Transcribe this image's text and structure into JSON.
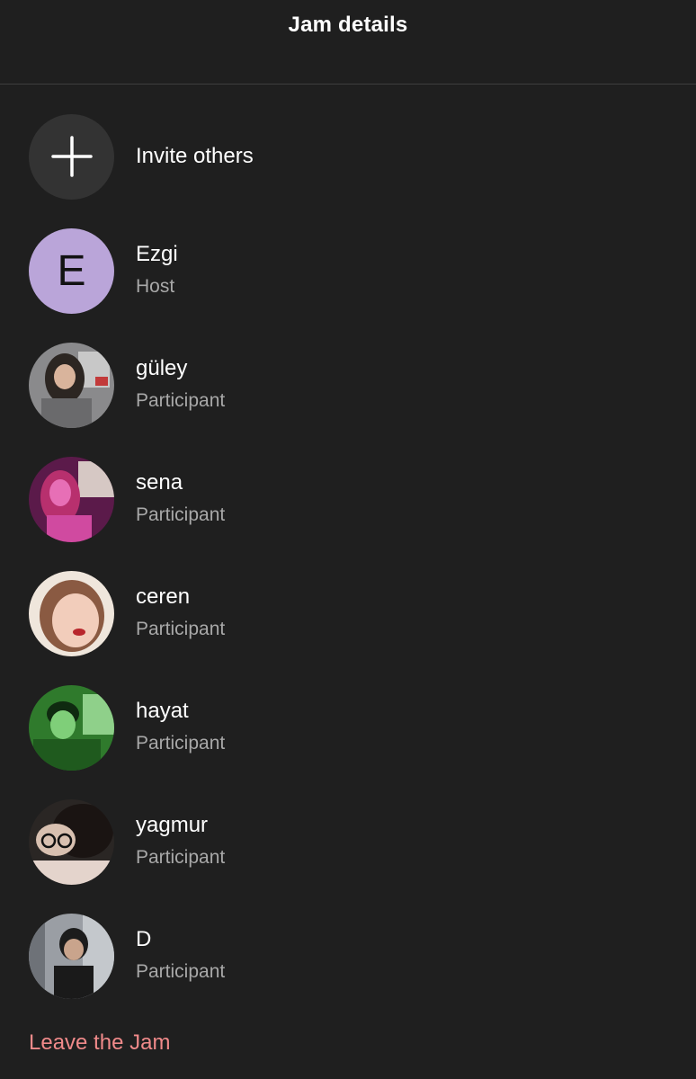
{
  "header": {
    "title": "Jam details"
  },
  "invite": {
    "label": "Invite others",
    "icon": "plus-icon"
  },
  "participants": [
    {
      "name": "Ezgi",
      "role": "Host",
      "avatar_letter": "E",
      "avatar_color": "#baa5d9"
    },
    {
      "name": "güley",
      "role": "Participant",
      "avatar_tone": "#6e6e70"
    },
    {
      "name": "sena",
      "role": "Participant",
      "avatar_tone": "#b0308f"
    },
    {
      "name": "ceren",
      "role": "Participant",
      "avatar_tone": "#d9b7a5"
    },
    {
      "name": "hayat",
      "role": "Participant",
      "avatar_tone": "#3c9a3a"
    },
    {
      "name": "yagmur",
      "role": "Participant",
      "avatar_tone": "#4a4240"
    },
    {
      "name": "D",
      "role": "Participant",
      "avatar_tone": "#5a5f66"
    }
  ],
  "footer": {
    "leave_label": "Leave the Jam"
  },
  "colors": {
    "background": "#1f1f1f",
    "leave": "#f08a8a",
    "secondary_text": "#a8a8a8"
  }
}
